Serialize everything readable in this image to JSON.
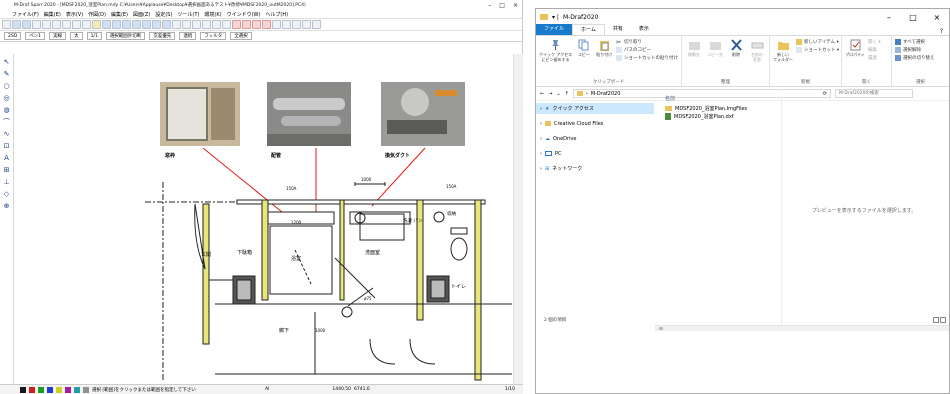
{
  "cad": {
    "title": "M-Draf Sparr 2020 - [MDSF2020_浴室Plan.mdy C:¥Users¥Applause¥Desktop¥選択画面あるテスト¥改修¥MDSF2020_outM2020].PC4)",
    "window_controls": [
      "–",
      "□",
      "×"
    ],
    "menu": [
      "ファイル(F)",
      "編集(E)",
      "表示(V)",
      "作図(D)",
      "編集(E)",
      "図面(Z)",
      "設定(S)",
      "ツール(T)",
      "環境(K)",
      "ウインドウ(W)",
      "ヘルプ(H)"
    ],
    "options_bar": {
      "layer": "2SD",
      "pen": "ペン1",
      "line": "実線",
      "width": "太",
      "scale": "1/1",
      "select": "選択範囲外切断",
      "snap": "交差優先",
      "mode": "連続",
      "filter": "フィルタ",
      "all": "全選択"
    },
    "left_tools": [
      "↖",
      "✎",
      "○",
      "◎",
      "◍",
      "⌒",
      "∿",
      "⊡",
      "A",
      "⊞",
      "⊥",
      "◇",
      "⊕"
    ],
    "photos": [
      {
        "caption": "窓枠"
      },
      {
        "caption": "配管"
      },
      {
        "caption": "換気ダクト"
      }
    ],
    "plan_labels": {
      "entrance": "玄関",
      "shoe_box": "下駄箱",
      "bathroom": "浴室",
      "washroom": "洗面室",
      "laundry": "洗濯\nパン",
      "toilet": "トイレ",
      "hallway": "廊下",
      "storage": "収納",
      "dim_top": "1000",
      "dim_bath": "1200",
      "dim_hall": "1000",
      "mark_a": "150A",
      "mark_b": "150A",
      "section": "ø75"
    },
    "status": {
      "message": "選択 [範囲]をクリックまたは範囲を指定して下さい",
      "coord_x": "1440.50",
      "coord_y": "6741.6",
      "mode": "AI",
      "scale": "1/10"
    },
    "status_colors": [
      "#1a1a1a",
      "#d02020",
      "#20a020",
      "#2040d0",
      "#d0d020",
      "#a020a0",
      "#20a0a0",
      "#909090"
    ]
  },
  "explorer": {
    "title": "M-Draf2020",
    "title_prefix": "▾ |",
    "tabs": [
      "ファイル",
      "ホーム",
      "共有",
      "表示"
    ],
    "ribbon": {
      "clipboard": {
        "label": "クリップボード",
        "pin": "クイック アクセス\nにピン留めする",
        "copy": "コピー",
        "paste": "貼り付け",
        "cut": "切り取り",
        "copy_path": "パスのコピー",
        "paste_shortcut": "ショートカットの貼り付け"
      },
      "organize": {
        "label": "整理",
        "move": "移動先",
        "copy_to": "コピー先",
        "delete": "削除",
        "rename": "名前の\n変更"
      },
      "new": {
        "label": "新規",
        "new_folder": "新しい\nフォルダー",
        "new_item": "新しいアイテム ▾",
        "shortcut": "ショートカット ▾"
      },
      "open": {
        "label": "開く",
        "properties": "プロパティ",
        "open": "開く ▾",
        "edit": "編集",
        "history": "履歴"
      },
      "select": {
        "label": "選択",
        "select_all": "すべて選択",
        "select_none": "選択解除",
        "invert": "選択の切り替え"
      }
    },
    "address": {
      "path": "M-Draf2020",
      "search_placeholder": "M-Draf2020の検索"
    },
    "nav": [
      {
        "label": "クイック アクセス",
        "icon": "star-icon"
      },
      {
        "label": "Creative Cloud Files",
        "icon": "folder-icon"
      },
      {
        "label": "OneDrive",
        "icon": "cloud-icon"
      },
      {
        "label": "PC",
        "icon": "pc-icon"
      },
      {
        "label": "ネットワーク",
        "icon": "network-icon"
      }
    ],
    "column_header": "名前",
    "files": [
      {
        "name": "MDSF2020_浴室Plan.ImgFiles",
        "icon": "folder-icon"
      },
      {
        "name": "MDSF2020_浴室Plan.dxf",
        "icon": "dxf-file-icon"
      }
    ],
    "preview_text": "プレビューを表示するファイルを選択します。",
    "item_count": "2 個の項目"
  }
}
